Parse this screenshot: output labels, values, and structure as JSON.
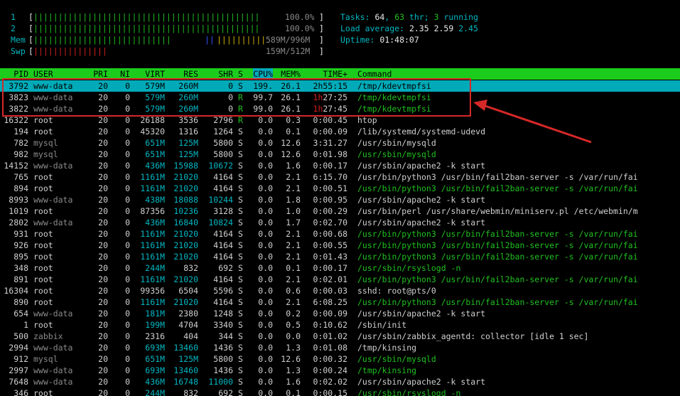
{
  "meters": {
    "cpu1": {
      "label": "1",
      "value": "100.0%",
      "bars": "||||||||||||||||||||||||||||||||||||||||||||||"
    },
    "cpu2": {
      "label": "2",
      "value": "100.0%",
      "bars": "||||||||||||||||||||||||||||||||||||||||||||||"
    },
    "mem": {
      "label": "Mem",
      "value": "589M/996M",
      "bars_green": "||||||||||||||||||||||||||||",
      "bars_blue": "||",
      "bars_yellow": "||||||||||"
    },
    "swp": {
      "label": "Swp",
      "value": "159M/512M",
      "bars_red": "|||||||||||||||"
    }
  },
  "summary": {
    "tasks_label": "Tasks: ",
    "tasks": "64",
    "thr_sep": ", ",
    "thr": "63",
    "thr_label": " thr; ",
    "running": "3",
    "running_label": " running",
    "load_label": "Load average: ",
    "load1": "2.35",
    "load5": "2.59",
    "load15": "2.45",
    "uptime_label": "Uptime: ",
    "uptime": "01:48:07"
  },
  "columns": [
    "PID",
    "USER",
    "PRI",
    "NI",
    "VIRT",
    "RES",
    "SHR",
    "S",
    "CPU%",
    "MEM%",
    "TIME+",
    "Command"
  ],
  "processes": [
    {
      "pid": "3792",
      "user": "www-data",
      "pri": "20",
      "ni": "0",
      "virt": "579M",
      "res": "260M",
      "shr": "0",
      "s": "S",
      "cpu": "199.",
      "mem": "26.1",
      "time": "2h55:15",
      "cmd": "/tmp/kdevtmpfsi",
      "cmd_color": "normal",
      "selected": true
    },
    {
      "pid": "3823",
      "user": "www-data",
      "pri": "20",
      "ni": "0",
      "virt": "579M",
      "res": "260M",
      "shr": "0",
      "s": "R",
      "cpu": "99.7",
      "mem": "26.1",
      "time": "1h27:25",
      "cmd": "/tmp/kdevtmpfsi",
      "cmd_color": "green"
    },
    {
      "pid": "3822",
      "user": "www-data",
      "pri": "20",
      "ni": "0",
      "virt": "579M",
      "res": "260M",
      "shr": "0",
      "s": "R",
      "cpu": "99.0",
      "mem": "26.1",
      "time": "1h27:45",
      "cmd": "/tmp/kdevtmpfsi",
      "cmd_color": "green"
    },
    {
      "pid": "16322",
      "user": "root",
      "pri": "20",
      "ni": "0",
      "virt": "26188",
      "res": "3536",
      "shr": "2796",
      "s": "R",
      "cpu": "0.0",
      "mem": "0.3",
      "time": "0:00.45",
      "cmd": "htop",
      "cmd_color": "normal"
    },
    {
      "pid": "194",
      "user": "root",
      "pri": "20",
      "ni": "0",
      "virt": "45320",
      "res": "1316",
      "shr": "1264",
      "s": "S",
      "cpu": "0.0",
      "mem": "0.1",
      "time": "0:00.09",
      "cmd": "/lib/systemd/systemd-udevd",
      "cmd_color": "normal"
    },
    {
      "pid": "782",
      "user": "mysql",
      "pri": "20",
      "ni": "0",
      "virt": "651M",
      "res": "125M",
      "shr": "5800",
      "s": "S",
      "cpu": "0.0",
      "mem": "12.6",
      "time": "3:31.27",
      "cmd": "/usr/sbin/mysqld",
      "cmd_color": "normal"
    },
    {
      "pid": "982",
      "user": "mysql",
      "pri": "20",
      "ni": "0",
      "virt": "651M",
      "res": "125M",
      "shr": "5800",
      "s": "S",
      "cpu": "0.0",
      "mem": "12.6",
      "time": "0:01.98",
      "cmd": "/usr/sbin/mysqld",
      "cmd_color": "green"
    },
    {
      "pid": "14152",
      "user": "www-data",
      "pri": "20",
      "ni": "0",
      "virt": "436M",
      "res": "15988",
      "shr": "10672",
      "s": "S",
      "cpu": "0.0",
      "mem": "1.6",
      "time": "0:00.17",
      "cmd": "/usr/sbin/apache2 -k start",
      "cmd_color": "normal"
    },
    {
      "pid": "765",
      "user": "root",
      "pri": "20",
      "ni": "0",
      "virt": "1161M",
      "res": "21020",
      "shr": "4164",
      "s": "S",
      "cpu": "0.0",
      "mem": "2.1",
      "time": "6:15.70",
      "cmd": "/usr/bin/python3 /usr/bin/fail2ban-server -s /var/run/fai",
      "cmd_color": "normal"
    },
    {
      "pid": "894",
      "user": "root",
      "pri": "20",
      "ni": "0",
      "virt": "1161M",
      "res": "21020",
      "shr": "4164",
      "s": "S",
      "cpu": "0.0",
      "mem": "2.1",
      "time": "0:00.51",
      "cmd": "/usr/bin/python3 /usr/bin/fail2ban-server -s /var/run/fai",
      "cmd_color": "green"
    },
    {
      "pid": "8993",
      "user": "www-data",
      "pri": "20",
      "ni": "0",
      "virt": "438M",
      "res": "18088",
      "shr": "10244",
      "s": "S",
      "cpu": "0.0",
      "mem": "1.8",
      "time": "0:00.95",
      "cmd": "/usr/sbin/apache2 -k start",
      "cmd_color": "normal"
    },
    {
      "pid": "1019",
      "user": "root",
      "pri": "20",
      "ni": "0",
      "virt": "87356",
      "res": "10236",
      "shr": "3128",
      "s": "S",
      "cpu": "0.0",
      "mem": "1.0",
      "time": "0:00.29",
      "cmd": "/usr/bin/perl /usr/share/webmin/miniserv.pl /etc/webmin/m",
      "cmd_color": "normal"
    },
    {
      "pid": "2802",
      "user": "www-data",
      "pri": "20",
      "ni": "0",
      "virt": "436M",
      "res": "16840",
      "shr": "10824",
      "s": "S",
      "cpu": "0.0",
      "mem": "1.7",
      "time": "0:02.70",
      "cmd": "/usr/sbin/apache2 -k start",
      "cmd_color": "normal"
    },
    {
      "pid": "931",
      "user": "root",
      "pri": "20",
      "ni": "0",
      "virt": "1161M",
      "res": "21020",
      "shr": "4164",
      "s": "S",
      "cpu": "0.0",
      "mem": "2.1",
      "time": "0:00.68",
      "cmd": "/usr/bin/python3 /usr/bin/fail2ban-server -s /var/run/fai",
      "cmd_color": "green"
    },
    {
      "pid": "926",
      "user": "root",
      "pri": "20",
      "ni": "0",
      "virt": "1161M",
      "res": "21020",
      "shr": "4164",
      "s": "S",
      "cpu": "0.0",
      "mem": "2.1",
      "time": "0:00.55",
      "cmd": "/usr/bin/python3 /usr/bin/fail2ban-server -s /var/run/fai",
      "cmd_color": "green"
    },
    {
      "pid": "895",
      "user": "root",
      "pri": "20",
      "ni": "0",
      "virt": "1161M",
      "res": "21020",
      "shr": "4164",
      "s": "S",
      "cpu": "0.0",
      "mem": "2.1",
      "time": "0:01.43",
      "cmd": "/usr/bin/python3 /usr/bin/fail2ban-server -s /var/run/fai",
      "cmd_color": "green"
    },
    {
      "pid": "348",
      "user": "root",
      "pri": "20",
      "ni": "0",
      "virt": "244M",
      "res": "832",
      "shr": "692",
      "s": "S",
      "cpu": "0.0",
      "mem": "0.1",
      "time": "0:00.17",
      "cmd": "/usr/sbin/rsyslogd -n",
      "cmd_color": "green"
    },
    {
      "pid": "891",
      "user": "root",
      "pri": "20",
      "ni": "0",
      "virt": "1161M",
      "res": "21020",
      "shr": "4164",
      "s": "S",
      "cpu": "0.0",
      "mem": "2.1",
      "time": "0:02.01",
      "cmd": "/usr/bin/python3 /usr/bin/fail2ban-server -s /var/run/fai",
      "cmd_color": "green"
    },
    {
      "pid": "16304",
      "user": "root",
      "pri": "20",
      "ni": "0",
      "virt": "99356",
      "res": "6504",
      "shr": "5596",
      "s": "S",
      "cpu": "0.0",
      "mem": "0.6",
      "time": "0:00.03",
      "cmd": "sshd: root@pts/0",
      "cmd_color": "normal"
    },
    {
      "pid": "890",
      "user": "root",
      "pri": "20",
      "ni": "0",
      "virt": "1161M",
      "res": "21020",
      "shr": "4164",
      "s": "S",
      "cpu": "0.0",
      "mem": "2.1",
      "time": "6:08.25",
      "cmd": "/usr/bin/python3 /usr/bin/fail2ban-server -s /var/run/fai",
      "cmd_color": "green"
    },
    {
      "pid": "654",
      "user": "www-data",
      "pri": "20",
      "ni": "0",
      "virt": "181M",
      "res": "2380",
      "shr": "1248",
      "s": "S",
      "cpu": "0.0",
      "mem": "0.2",
      "time": "0:00.09",
      "cmd": "/usr/sbin/apache2 -k start",
      "cmd_color": "normal"
    },
    {
      "pid": "1",
      "user": "root",
      "pri": "20",
      "ni": "0",
      "virt": "199M",
      "res": "4704",
      "shr": "3340",
      "s": "S",
      "cpu": "0.0",
      "mem": "0.5",
      "time": "0:10.62",
      "cmd": "/sbin/init",
      "cmd_color": "normal"
    },
    {
      "pid": "500",
      "user": "zabbix",
      "pri": "20",
      "ni": "0",
      "virt": "2316",
      "res": "404",
      "shr": "344",
      "s": "S",
      "cpu": "0.0",
      "mem": "0.0",
      "time": "0:01.02",
      "cmd": "/usr/sbin/zabbix_agentd: collector [idle 1 sec]",
      "cmd_color": "normal"
    },
    {
      "pid": "2994",
      "user": "www-data",
      "pri": "20",
      "ni": "0",
      "virt": "693M",
      "res": "13460",
      "shr": "1436",
      "s": "S",
      "cpu": "0.0",
      "mem": "1.3",
      "time": "0:01.08",
      "cmd": "/tmp/kinsing",
      "cmd_color": "normal"
    },
    {
      "pid": "912",
      "user": "mysql",
      "pri": "20",
      "ni": "0",
      "virt": "651M",
      "res": "125M",
      "shr": "5800",
      "s": "S",
      "cpu": "0.0",
      "mem": "12.6",
      "time": "0:00.32",
      "cmd": "/usr/sbin/mysqld",
      "cmd_color": "green"
    },
    {
      "pid": "2997",
      "user": "www-data",
      "pri": "20",
      "ni": "0",
      "virt": "693M",
      "res": "13460",
      "shr": "1436",
      "s": "S",
      "cpu": "0.0",
      "mem": "1.3",
      "time": "0:00.24",
      "cmd": "/tmp/kinsing",
      "cmd_color": "green"
    },
    {
      "pid": "7648",
      "user": "www-data",
      "pri": "20",
      "ni": "0",
      "virt": "436M",
      "res": "16748",
      "shr": "11000",
      "s": "S",
      "cpu": "0.0",
      "mem": "1.6",
      "time": "0:02.02",
      "cmd": "/usr/sbin/apache2 -k start",
      "cmd_color": "normal"
    },
    {
      "pid": "346",
      "user": "root",
      "pri": "20",
      "ni": "0",
      "virt": "244M",
      "res": "832",
      "shr": "692",
      "s": "S",
      "cpu": "0.0",
      "mem": "0.1",
      "time": "0:00.15",
      "cmd": "/usr/sbin/rsyslogd -n",
      "cmd_color": "green"
    }
  ],
  "annotation": {
    "box_color": "#d62828",
    "arrow_color": "#d62828"
  }
}
